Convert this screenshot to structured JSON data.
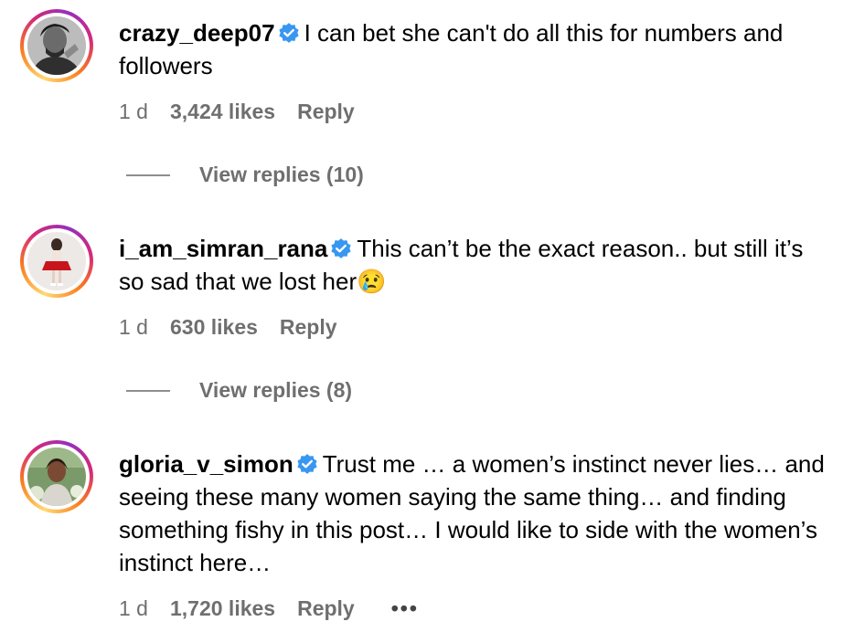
{
  "colors": {
    "verified": "#3897f0",
    "meta": "#6f6f6f"
  },
  "comments": [
    {
      "username": "crazy_deep07",
      "text": "I can bet she can't do all this for numbers and followers",
      "time": "1 d",
      "likes": "3,424 likes",
      "reply": "Reply",
      "view_replies": "View replies (10)"
    },
    {
      "username": "i_am_simran_rana",
      "text": "This can’t be the exact reason.. but still it’s so sad that we lost her😢",
      "time": "1 d",
      "likes": "630 likes",
      "reply": "Reply",
      "view_replies": "View replies (8)"
    },
    {
      "username": "gloria_v_simon",
      "text": "Trust me … a women’s instinct never lies… and seeing these many women saying the same thing… and finding something fishy in this post… I would like to side with the women’s instinct here…",
      "time": "1 d",
      "likes": "1,720 likes",
      "reply": "Reply",
      "more": "•••"
    }
  ]
}
